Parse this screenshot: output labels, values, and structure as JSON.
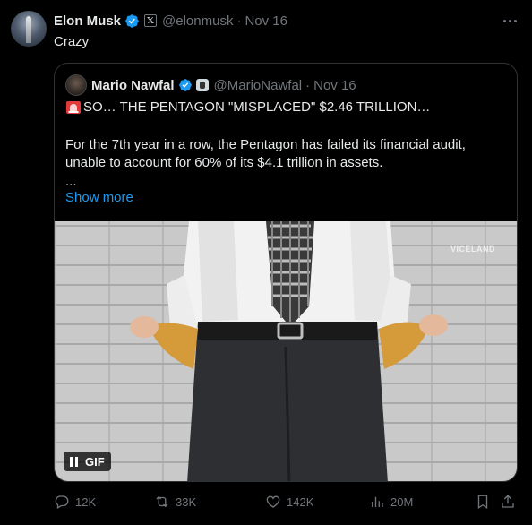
{
  "tweet": {
    "author_name": "Elon Musk",
    "author_handle": "@elonmusk",
    "separator": "·",
    "date": "Nov 16",
    "affiliate_badge": "𝕏",
    "text": "Crazy",
    "icons": {
      "avatar": "avatar",
      "verified": "verified-badge-icon",
      "more": "more-options-icon"
    }
  },
  "quote": {
    "author_name": "Mario Nawfal",
    "author_handle": "@MarioNawfal",
    "separator": "·",
    "date": "Nov 16",
    "headline": "SO… THE PENTAGON \"MISPLACED\" $2.46 TRILLION…",
    "body": "For the 7th  year in a row, the Pentagon has failed its financial audit, unable to account for 60% of its $4.1 trillion in assets.",
    "ellipsis": "...",
    "show_more": "Show more",
    "media": {
      "watermark": "VICELAND",
      "badge": "GIF",
      "description_icon": "pause-icon"
    }
  },
  "actions": {
    "replies": "12K",
    "reposts": "33K",
    "likes": "142K",
    "views": "20M"
  },
  "colors": {
    "background": "#000000",
    "text": "#e7e9ea",
    "muted": "#71767b",
    "accent": "#1d9bf0",
    "border": "#2f3336"
  }
}
